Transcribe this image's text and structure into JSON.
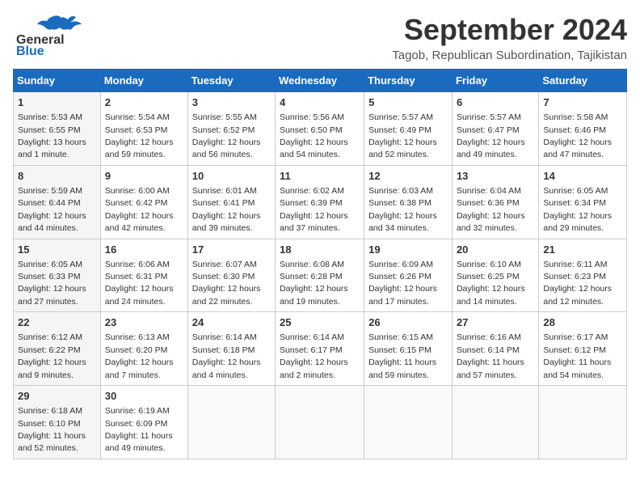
{
  "header": {
    "logo_general": "General",
    "logo_blue": "Blue",
    "month_title": "September 2024",
    "location": "Tagob, Republican Subordination, Tajikistan"
  },
  "columns": [
    "Sunday",
    "Monday",
    "Tuesday",
    "Wednesday",
    "Thursday",
    "Friday",
    "Saturday"
  ],
  "weeks": [
    [
      {
        "day": "1",
        "info": "Sunrise: 5:53 AM\nSunset: 6:55 PM\nDaylight: 13 hours\nand 1 minute."
      },
      {
        "day": "2",
        "info": "Sunrise: 5:54 AM\nSunset: 6:53 PM\nDaylight: 12 hours\nand 59 minutes."
      },
      {
        "day": "3",
        "info": "Sunrise: 5:55 AM\nSunset: 6:52 PM\nDaylight: 12 hours\nand 56 minutes."
      },
      {
        "day": "4",
        "info": "Sunrise: 5:56 AM\nSunset: 6:50 PM\nDaylight: 12 hours\nand 54 minutes."
      },
      {
        "day": "5",
        "info": "Sunrise: 5:57 AM\nSunset: 6:49 PM\nDaylight: 12 hours\nand 52 minutes."
      },
      {
        "day": "6",
        "info": "Sunrise: 5:57 AM\nSunset: 6:47 PM\nDaylight: 12 hours\nand 49 minutes."
      },
      {
        "day": "7",
        "info": "Sunrise: 5:58 AM\nSunset: 6:46 PM\nDaylight: 12 hours\nand 47 minutes."
      }
    ],
    [
      {
        "day": "8",
        "info": "Sunrise: 5:59 AM\nSunset: 6:44 PM\nDaylight: 12 hours\nand 44 minutes."
      },
      {
        "day": "9",
        "info": "Sunrise: 6:00 AM\nSunset: 6:42 PM\nDaylight: 12 hours\nand 42 minutes."
      },
      {
        "day": "10",
        "info": "Sunrise: 6:01 AM\nSunset: 6:41 PM\nDaylight: 12 hours\nand 39 minutes."
      },
      {
        "day": "11",
        "info": "Sunrise: 6:02 AM\nSunset: 6:39 PM\nDaylight: 12 hours\nand 37 minutes."
      },
      {
        "day": "12",
        "info": "Sunrise: 6:03 AM\nSunset: 6:38 PM\nDaylight: 12 hours\nand 34 minutes."
      },
      {
        "day": "13",
        "info": "Sunrise: 6:04 AM\nSunset: 6:36 PM\nDaylight: 12 hours\nand 32 minutes."
      },
      {
        "day": "14",
        "info": "Sunrise: 6:05 AM\nSunset: 6:34 PM\nDaylight: 12 hours\nand 29 minutes."
      }
    ],
    [
      {
        "day": "15",
        "info": "Sunrise: 6:05 AM\nSunset: 6:33 PM\nDaylight: 12 hours\nand 27 minutes."
      },
      {
        "day": "16",
        "info": "Sunrise: 6:06 AM\nSunset: 6:31 PM\nDaylight: 12 hours\nand 24 minutes."
      },
      {
        "day": "17",
        "info": "Sunrise: 6:07 AM\nSunset: 6:30 PM\nDaylight: 12 hours\nand 22 minutes."
      },
      {
        "day": "18",
        "info": "Sunrise: 6:08 AM\nSunset: 6:28 PM\nDaylight: 12 hours\nand 19 minutes."
      },
      {
        "day": "19",
        "info": "Sunrise: 6:09 AM\nSunset: 6:26 PM\nDaylight: 12 hours\nand 17 minutes."
      },
      {
        "day": "20",
        "info": "Sunrise: 6:10 AM\nSunset: 6:25 PM\nDaylight: 12 hours\nand 14 minutes."
      },
      {
        "day": "21",
        "info": "Sunrise: 6:11 AM\nSunset: 6:23 PM\nDaylight: 12 hours\nand 12 minutes."
      }
    ],
    [
      {
        "day": "22",
        "info": "Sunrise: 6:12 AM\nSunset: 6:22 PM\nDaylight: 12 hours\nand 9 minutes."
      },
      {
        "day": "23",
        "info": "Sunrise: 6:13 AM\nSunset: 6:20 PM\nDaylight: 12 hours\nand 7 minutes."
      },
      {
        "day": "24",
        "info": "Sunrise: 6:14 AM\nSunset: 6:18 PM\nDaylight: 12 hours\nand 4 minutes."
      },
      {
        "day": "25",
        "info": "Sunrise: 6:14 AM\nSunset: 6:17 PM\nDaylight: 12 hours\nand 2 minutes."
      },
      {
        "day": "26",
        "info": "Sunrise: 6:15 AM\nSunset: 6:15 PM\nDaylight: 11 hours\nand 59 minutes."
      },
      {
        "day": "27",
        "info": "Sunrise: 6:16 AM\nSunset: 6:14 PM\nDaylight: 11 hours\nand 57 minutes."
      },
      {
        "day": "28",
        "info": "Sunrise: 6:17 AM\nSunset: 6:12 PM\nDaylight: 11 hours\nand 54 minutes."
      }
    ],
    [
      {
        "day": "29",
        "info": "Sunrise: 6:18 AM\nSunset: 6:10 PM\nDaylight: 11 hours\nand 52 minutes."
      },
      {
        "day": "30",
        "info": "Sunrise: 6:19 AM\nSunset: 6:09 PM\nDaylight: 11 hours\nand 49 minutes."
      },
      {
        "day": "",
        "info": ""
      },
      {
        "day": "",
        "info": ""
      },
      {
        "day": "",
        "info": ""
      },
      {
        "day": "",
        "info": ""
      },
      {
        "day": "",
        "info": ""
      }
    ]
  ]
}
